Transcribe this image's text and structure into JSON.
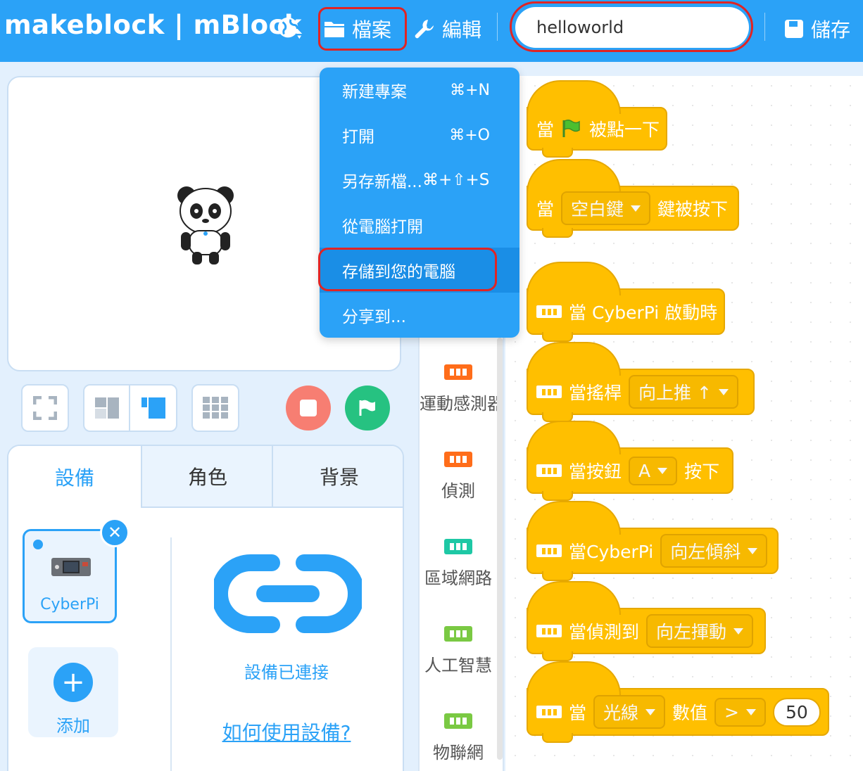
{
  "topbar": {
    "logo": "makeblock | mBlock",
    "file_label": "檔案",
    "edit_label": "編輯",
    "project_name": "helloworld",
    "save_label": "儲存"
  },
  "file_menu": {
    "items": [
      {
        "label": "新建專案",
        "shortcut": "⌘+N"
      },
      {
        "label": "打開",
        "shortcut": "⌘+O"
      },
      {
        "label": "另存新檔...",
        "shortcut": "⌘+⇧+S"
      },
      {
        "label": "從電腦打開",
        "shortcut": ""
      },
      {
        "label": "存儲到您的電腦",
        "shortcut": ""
      },
      {
        "label": "分享到...",
        "shortcut": ""
      }
    ]
  },
  "device_panel": {
    "tabs": [
      "設備",
      "角色",
      "背景"
    ],
    "device_name": "CyberPi",
    "add_label": "添加",
    "connected_text": "設備已連接",
    "howto_link": "如何使用設備?"
  },
  "categories": [
    {
      "label": "運動感測器",
      "color": "#ff6d1a"
    },
    {
      "label": "偵測",
      "color": "#ff6d1a"
    },
    {
      "label": "區域網路",
      "color": "#1ec8a5"
    },
    {
      "label": "人工智慧",
      "color": "#7ac943"
    },
    {
      "label": "物聯網",
      "color": "#7ac943"
    }
  ],
  "blocks": {
    "b1": {
      "pre": "當",
      "post": "被點一下"
    },
    "b2": {
      "pre": "當",
      "dd": "空白鍵",
      "post": "鍵被按下"
    },
    "b3": {
      "text": "當 CyberPi 啟動時"
    },
    "b4": {
      "pre": "當搖桿",
      "dd": "向上推 ↑"
    },
    "b5": {
      "pre": "當按鈕",
      "dd": "A",
      "post": "按下"
    },
    "b6": {
      "pre": "當CyberPi",
      "dd": "向左傾斜"
    },
    "b7": {
      "pre": "當偵測到",
      "dd": "向左揮動"
    },
    "b8": {
      "pre": "當",
      "dd": "光線",
      "mid": "數值",
      "dd2": ">",
      "value": "50"
    }
  },
  "colors": {
    "brand_blue": "#2ba2f7",
    "event_yellow": "#ffbf00",
    "stop_red": "#f77e72",
    "go_green": "#26c281",
    "highlight_red": "#e02424"
  }
}
